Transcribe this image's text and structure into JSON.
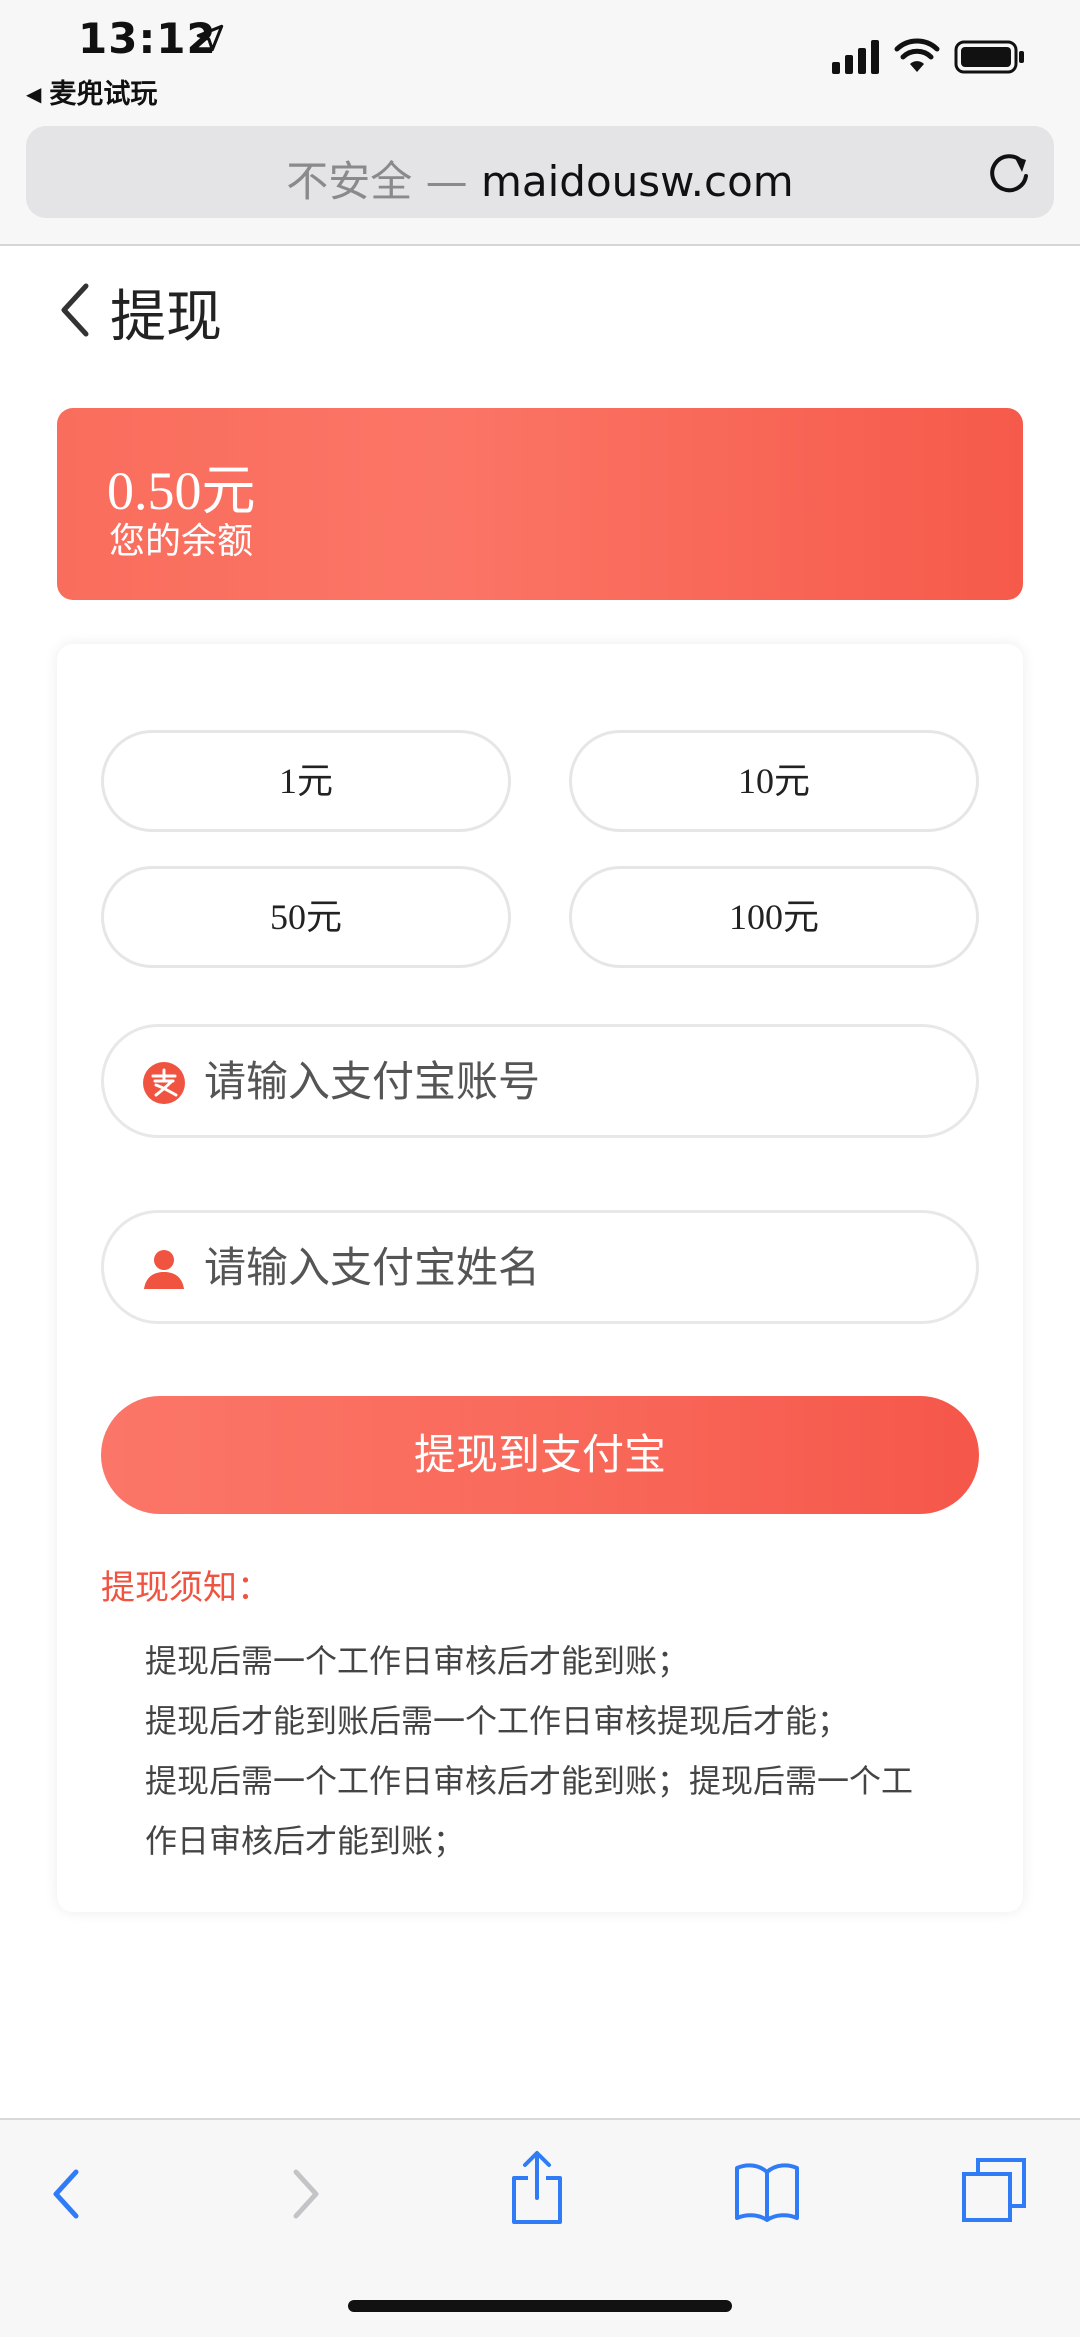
{
  "status_bar": {
    "time": "13:12",
    "back_app": "麦兜试玩"
  },
  "browser": {
    "insecure_label": "不安全 —",
    "domain": "maidousw.com"
  },
  "header": {
    "title": "提现"
  },
  "balance": {
    "amount": "0.50元",
    "label": "您的余额"
  },
  "amounts": [
    "1元",
    "10元",
    "50元",
    "100元"
  ],
  "form": {
    "account_placeholder": "请输入支付宝账号",
    "name_placeholder": "请输入支付宝姓名",
    "submit_label": "提现到支付宝"
  },
  "notice": {
    "title": "提现须知：",
    "lines": [
      "提现后需一个工作日审核后才能到账；",
      "提现后才能到账后需一个工作日审核提现后才能；",
      "提现后需一个工作日审核后才能到账；提现后需一个工",
      "作日审核后才能到账；"
    ]
  },
  "colors": {
    "accent": "#f65a4a",
    "ios_blue": "#2f7cf6"
  }
}
